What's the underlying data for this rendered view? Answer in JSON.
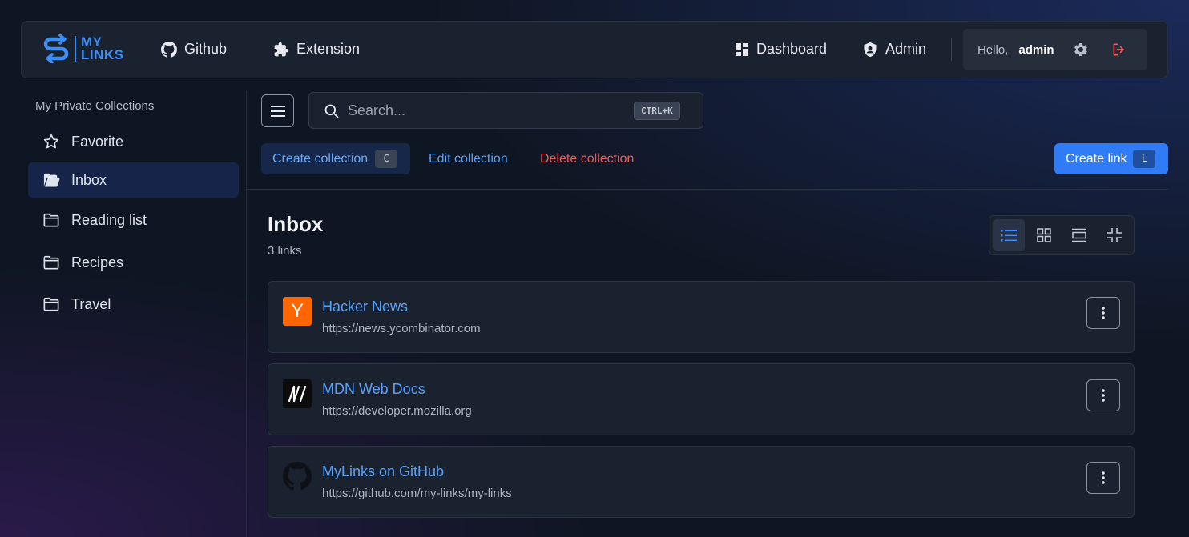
{
  "navbar": {
    "logo_text_line1": "MY",
    "logo_text_line2": "LINKS",
    "github_label": "Github",
    "extension_label": "Extension",
    "dashboard_label": "Dashboard",
    "admin_label": "Admin",
    "hello_label": "Hello,",
    "username": "admin"
  },
  "sidebar": {
    "title": "My Private Collections",
    "items": [
      {
        "label": "Favorite",
        "icon": "star-icon"
      },
      {
        "label": "Inbox",
        "icon": "folder-open-icon",
        "active": true
      },
      {
        "label": "Reading list",
        "icon": "folder-icon"
      },
      {
        "label": "Recipes",
        "icon": "folder-icon"
      },
      {
        "label": "Travel",
        "icon": "folder-icon"
      }
    ]
  },
  "search": {
    "placeholder": "Search...",
    "shortcut": "CTRL+K"
  },
  "actions": {
    "create_collection": "Create collection",
    "create_collection_key": "C",
    "edit_collection": "Edit collection",
    "delete_collection": "Delete collection",
    "create_link": "Create link",
    "create_link_key": "L"
  },
  "collection": {
    "title": "Inbox",
    "count": "3 links"
  },
  "links": [
    {
      "title": "Hacker News",
      "url": "https://news.ycombinator.com",
      "icon_text": "Y"
    },
    {
      "title": "MDN Web Docs",
      "url": "https://developer.mozilla.org",
      "icon_text": "M"
    },
    {
      "title": "MyLinks on GitHub",
      "url": "https://github.com/my-links/my-links",
      "icon_text": ""
    }
  ],
  "colors": {
    "accent": "#3d8df5",
    "danger": "#ef5a5a",
    "primary_button": "#2f7cf6",
    "background": "#0f1623"
  }
}
